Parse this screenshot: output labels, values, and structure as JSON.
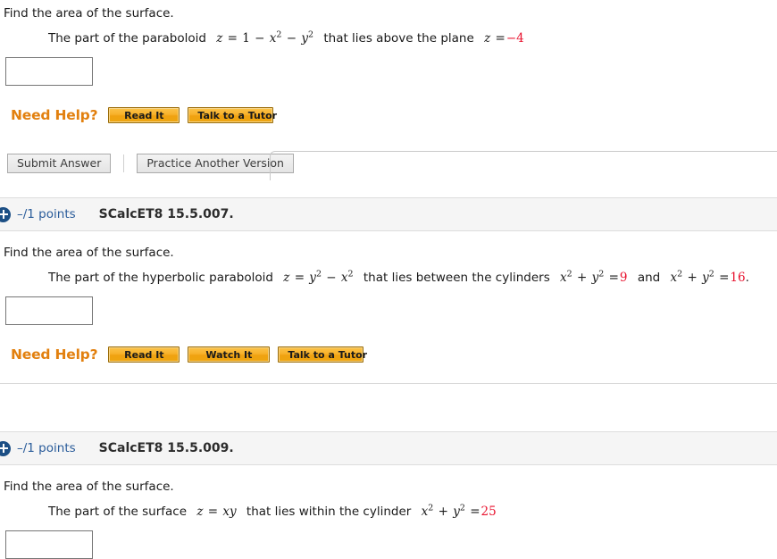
{
  "problems": [
    {
      "header": null,
      "prompt": "Find the area of the surface.",
      "statement": {
        "lead": "The part of the paraboloid",
        "mid": "that lies above the plane",
        "tail": ""
      },
      "answer_value": "",
      "need_help": {
        "label": "Need Help?",
        "buttons": [
          "Read It",
          "Talk to a Tutor"
        ]
      },
      "submit": {
        "submit_label": "Submit Answer",
        "practice_label": "Practice Another Version"
      }
    },
    {
      "header": {
        "points": "–/1 points",
        "id": "SCalcET8 15.5.007.",
        "icon": "plus-circle-icon"
      },
      "prompt": "Find the area of the surface.",
      "statement": {
        "lead": "The part of the hyperbolic paraboloid",
        "mid": "that lies between the cylinders",
        "conj": "and",
        "tail": "."
      },
      "answer_value": "",
      "need_help": {
        "label": "Need Help?",
        "buttons": [
          "Read It",
          "Watch It",
          "Talk to a Tutor"
        ]
      }
    },
    {
      "header": {
        "points": "–/1 points",
        "id": "SCalcET8 15.5.009.",
        "icon": "plus-circle-icon"
      },
      "prompt": "Find the area of the surface.",
      "statement": {
        "lead": "The part of the surface",
        "mid": "that lies within the cylinder"
      },
      "answer_value": ""
    }
  ],
  "math": {
    "p1_surface": {
      "lhs": "z",
      "eq": "=",
      "t1": "1",
      "op1": "−",
      "v1": "x",
      "e1": "2",
      "op2": "−",
      "v2": "y",
      "e2": "2"
    },
    "p1_plane": {
      "lhs": "z",
      "eq": "=",
      "value": "−4"
    },
    "p2_surface": {
      "lhs": "z",
      "eq": "=",
      "v1": "y",
      "e1": "2",
      "op": "−",
      "v2": "x",
      "e2": "2"
    },
    "p2_cyl1": {
      "v1": "x",
      "e1": "2",
      "op": "+",
      "v2": "y",
      "e2": "2",
      "eq": "=",
      "value": "9"
    },
    "p2_cyl2": {
      "v1": "x",
      "e1": "2",
      "op": "+",
      "v2": "y",
      "e2": "2",
      "eq": "=",
      "value": "16"
    },
    "p3_surface": {
      "lhs": "z",
      "eq": "=",
      "rhs": "xy"
    },
    "p3_cyl": {
      "v1": "x",
      "e1": "2",
      "op": "+",
      "v2": "y",
      "e2": "2",
      "eq": "=",
      "value": "25"
    }
  },
  "colors": {
    "accent_orange": "#e2800f",
    "link_blue": "#2a5c9a",
    "value_red": "#e8112d",
    "header_bg": "#f5f5f5",
    "icon_blue": "#1c4f85"
  }
}
